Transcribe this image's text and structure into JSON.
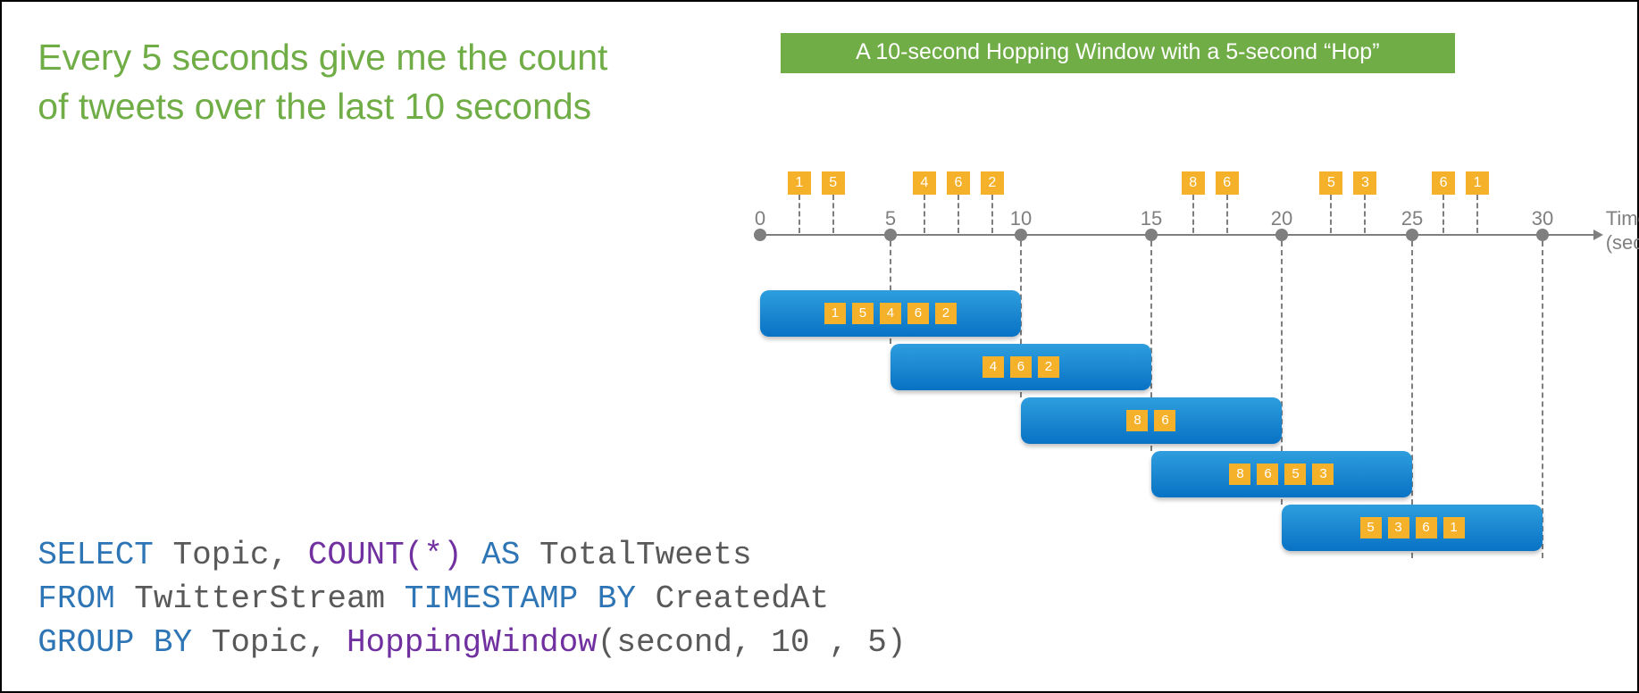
{
  "description": "Every 5 seconds give me the count of tweets over the last 10 seconds",
  "banner": "A 10-second Hopping Window with a 5-second “Hop”",
  "axis": {
    "label1": "Time",
    "label2": "(secs)",
    "ticks": [
      {
        "t": 0,
        "label": "0",
        "dash_h": 0
      },
      {
        "t": 5,
        "label": "5",
        "dash_h": 115
      },
      {
        "t": 10,
        "label": "10",
        "dash_h": 175
      },
      {
        "t": 15,
        "label": "15",
        "dash_h": 235
      },
      {
        "t": 20,
        "label": "20",
        "dash_h": 295
      },
      {
        "t": 25,
        "label": "25",
        "dash_h": 355
      },
      {
        "t": 30,
        "label": "30",
        "dash_h": 355
      }
    ]
  },
  "top_events": [
    {
      "t": 1.5,
      "v": "1"
    },
    {
      "t": 2.8,
      "v": "5"
    },
    {
      "t": 6.3,
      "v": "4"
    },
    {
      "t": 7.6,
      "v": "6"
    },
    {
      "t": 8.9,
      "v": "2"
    },
    {
      "t": 16.6,
      "v": "8"
    },
    {
      "t": 17.9,
      "v": "6"
    },
    {
      "t": 21.9,
      "v": "5"
    },
    {
      "t": 23.2,
      "v": "3"
    },
    {
      "t": 26.2,
      "v": "6"
    },
    {
      "t": 27.5,
      "v": "1"
    }
  ],
  "windows": [
    {
      "start": 0,
      "end": 10,
      "row": 0,
      "vals": [
        "1",
        "5",
        "4",
        "6",
        "2"
      ]
    },
    {
      "start": 5,
      "end": 15,
      "row": 1,
      "vals": [
        "4",
        "6",
        "2"
      ]
    },
    {
      "start": 10,
      "end": 20,
      "row": 2,
      "vals": [
        "8",
        "6"
      ]
    },
    {
      "start": 15,
      "end": 25,
      "row": 3,
      "vals": [
        "8",
        "6",
        "5",
        "3"
      ]
    },
    {
      "start": 20,
      "end": 30,
      "row": 4,
      "vals": [
        "5",
        "3",
        "6",
        "1"
      ]
    }
  ],
  "sql": {
    "k1": "SELECT",
    "p1": " Topic, ",
    "f1": "COUNT(*)",
    "k2": " AS",
    "p2": " TotalTweets",
    "k3": "FROM",
    "p3": " TwitterStream ",
    "k4": "TIMESTAMP BY",
    "p4": " CreatedAt",
    "k5": "GROUP BY",
    "p5": " Topic, ",
    "f2": "HoppingWindow",
    "p6": "(second, 10 , 5)"
  },
  "chart_data": {
    "type": "bar",
    "title": "A 10-second Hopping Window with a 5-second \"Hop\"",
    "xlabel": "Time (secs)",
    "ylabel": "",
    "ylim": [
      0,
      30
    ],
    "ticks": [
      0,
      5,
      10,
      15,
      20,
      25,
      30
    ],
    "events": [
      {
        "t": 1.5,
        "v": 1
      },
      {
        "t": 2.8,
        "v": 5
      },
      {
        "t": 6.3,
        "v": 4
      },
      {
        "t": 7.6,
        "v": 6
      },
      {
        "t": 8.9,
        "v": 2
      },
      {
        "t": 16.6,
        "v": 8
      },
      {
        "t": 17.9,
        "v": 6
      },
      {
        "t": 21.9,
        "v": 5
      },
      {
        "t": 23.2,
        "v": 3
      },
      {
        "t": 26.2,
        "v": 6
      },
      {
        "t": 27.5,
        "v": 1
      }
    ],
    "windows": [
      {
        "start": 0,
        "end": 10,
        "events": [
          1,
          5,
          4,
          6,
          2
        ],
        "count": 5
      },
      {
        "start": 5,
        "end": 15,
        "events": [
          4,
          6,
          2
        ],
        "count": 3
      },
      {
        "start": 10,
        "end": 20,
        "events": [
          8,
          6
        ],
        "count": 2
      },
      {
        "start": 15,
        "end": 25,
        "events": [
          8,
          6,
          5,
          3
        ],
        "count": 4
      },
      {
        "start": 20,
        "end": 30,
        "events": [
          5,
          3,
          6,
          1
        ],
        "count": 4
      }
    ]
  }
}
